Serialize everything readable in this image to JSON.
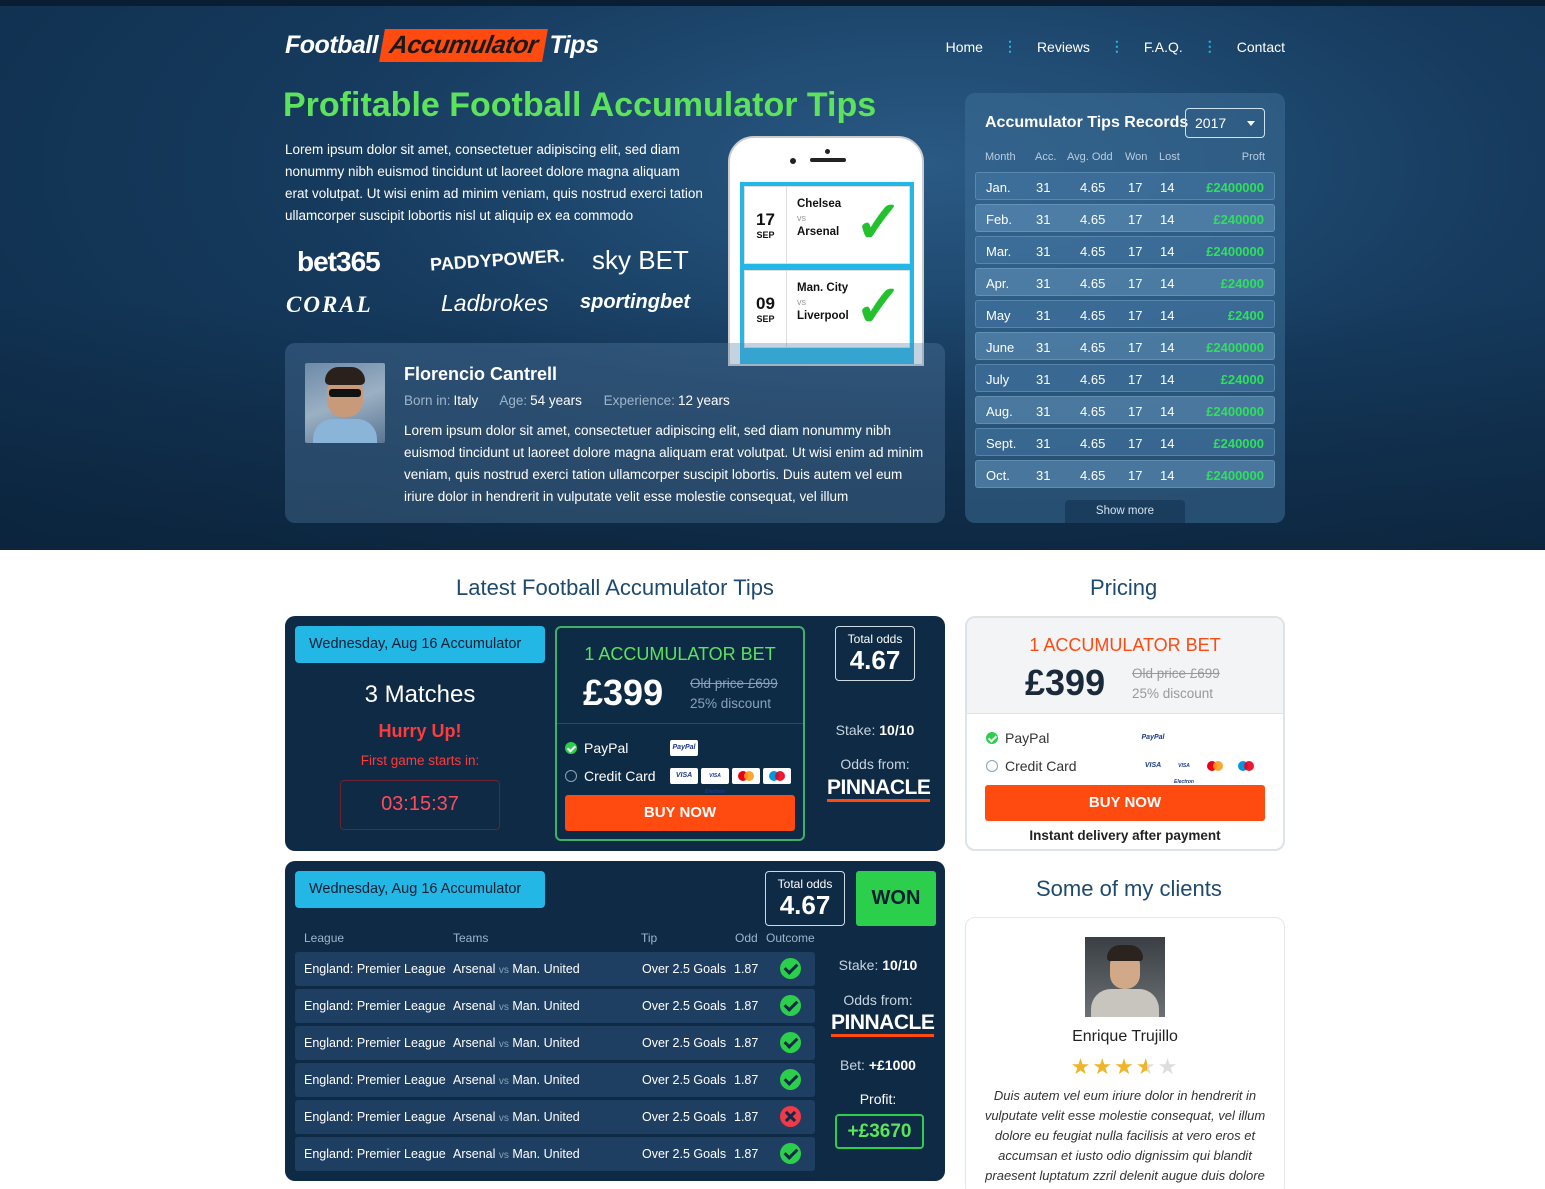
{
  "brand": {
    "part1": "Football",
    "part2": "Accumulator",
    "part3": "Tips"
  },
  "nav": [
    "Home",
    "Reviews",
    "F.A.Q.",
    "Contact"
  ],
  "hero": {
    "title": "Profitable Football Accumulator Tips",
    "intro": "Lorem ipsum dolor sit amet, consectetuer adipiscing elit, sed diam nonummy nibh euismod tincidunt ut laoreet dolore magna aliquam erat volutpat. Ut wisi enim ad minim veniam, quis nostrud exerci tation ullamcorper suscipit lobortis nisl ut aliquip ex ea commodo",
    "bookmakers": [
      "bet365",
      "PADDYPOWER.",
      "sky BET",
      "CORAL",
      "Ladbrokes",
      "sportingbet"
    ]
  },
  "phone": {
    "matches": [
      {
        "day": "17",
        "month": "SEP",
        "home": "Chelsea",
        "vs": "vs",
        "away": "Arsenal"
      },
      {
        "day": "09",
        "month": "SEP",
        "home": "Man. City",
        "vs": "vs",
        "away": "Liverpool"
      }
    ]
  },
  "tipster": {
    "name": "Florencio Cantrell",
    "born_label": "Born in:",
    "born": "Italy",
    "age_label": "Age:",
    "age": "54 years",
    "exp_label": "Experience:",
    "exp": "12 years",
    "bio": "Lorem ipsum dolor sit amet, consectetuer adipiscing elit, sed diam nonummy nibh euismod tincidunt ut laoreet dolore magna aliquam erat volutpat. Ut wisi enim ad minim veniam, quis nostrud exerci tation ullamcorper suscipit lobortis. Duis autem vel eum iriure dolor in hendrerit in vulputate velit esse molestie consequat, vel illum"
  },
  "records": {
    "title": "Accumulator Tips Records",
    "year": "2017",
    "headers": [
      "Month",
      "Acc.",
      "Avg. Odd",
      "Won",
      "Lost",
      "Proft"
    ],
    "rows": [
      [
        "Jan.",
        "31",
        "4.65",
        "17",
        "14",
        "£2400000"
      ],
      [
        "Feb.",
        "31",
        "4.65",
        "17",
        "14",
        "£240000"
      ],
      [
        "Mar.",
        "31",
        "4.65",
        "17",
        "14",
        "£2400000"
      ],
      [
        "Apr.",
        "31",
        "4.65",
        "17",
        "14",
        "£24000"
      ],
      [
        "May",
        "31",
        "4.65",
        "17",
        "14",
        "£2400"
      ],
      [
        "June",
        "31",
        "4.65",
        "17",
        "14",
        "£2400000"
      ],
      [
        "July",
        "31",
        "4.65",
        "17",
        "14",
        "£24000"
      ],
      [
        "Aug.",
        "31",
        "4.65",
        "17",
        "14",
        "£2400000"
      ],
      [
        "Sept.",
        "31",
        "4.65",
        "17",
        "14",
        "£240000"
      ],
      [
        "Oct.",
        "31",
        "4.65",
        "17",
        "14",
        "£2400000"
      ]
    ],
    "show_more": "Show more"
  },
  "latest": {
    "heading": "Latest Football Accumulator Tips",
    "card1": {
      "date": "Wednesday, Aug 16 Accumulator",
      "matches": "3 Matches",
      "hurry": "Hurry Up!",
      "starts": "First game starts in:",
      "countdown": "03:15:37",
      "offer_title": "1 ACCUMULATOR BET",
      "price": "£399",
      "old_price": "Old price £699",
      "discount": "25% discount",
      "paypal": "PayPal",
      "credit": "Credit Card",
      "buy": "BUY NOW",
      "total_label": "Total odds",
      "total": "4.67",
      "stake_label": "Stake:",
      "stake": "10/10",
      "odds_from": "Odds from:",
      "bookie": "PINNACLE"
    },
    "card2": {
      "date": "Wednesday, Aug 16 Accumulator",
      "total_label": "Total odds",
      "total": "4.67",
      "status": "WON",
      "headers": [
        "League",
        "Teams",
        "Tip",
        "Odd",
        "Outcome"
      ],
      "rows": [
        {
          "league": "England: Premier League",
          "home": "Arsenal",
          "vs": "vs",
          "away": "Man. United",
          "tip": "Over 2.5 Goals",
          "odd": "1.87",
          "outcome": "win"
        },
        {
          "league": "England: Premier League",
          "home": "Arsenal",
          "vs": "vs",
          "away": "Man. United",
          "tip": "Over 2.5 Goals",
          "odd": "1.87",
          "outcome": "win"
        },
        {
          "league": "England: Premier League",
          "home": "Arsenal",
          "vs": "vs",
          "away": "Man. United",
          "tip": "Over 2.5 Goals",
          "odd": "1.87",
          "outcome": "win"
        },
        {
          "league": "England: Premier League",
          "home": "Arsenal",
          "vs": "vs",
          "away": "Man. United",
          "tip": "Over 2.5 Goals",
          "odd": "1.87",
          "outcome": "win"
        },
        {
          "league": "England: Premier League",
          "home": "Arsenal",
          "vs": "vs",
          "away": "Man. United",
          "tip": "Over 2.5 Goals",
          "odd": "1.87",
          "outcome": "lose"
        },
        {
          "league": "England: Premier League",
          "home": "Arsenal",
          "vs": "vs",
          "away": "Man. United",
          "tip": "Over 2.5 Goals",
          "odd": "1.87",
          "outcome": "win"
        }
      ],
      "stake_label": "Stake:",
      "stake": "10/10",
      "odds_from": "Odds from:",
      "bookie": "PINNACLE",
      "bet_label": "Bet:",
      "bet": "+£1000",
      "profit_label": "Profit:",
      "profit": "+£3670"
    }
  },
  "pricing": {
    "heading": "Pricing",
    "title": "1 ACCUMULATOR BET",
    "price": "£399",
    "old_price": "Old price £699",
    "discount": "25% discount",
    "paypal": "PayPal",
    "credit": "Credit Card",
    "buy": "BUY NOW",
    "delivery": "Instant delivery after payment"
  },
  "clients": {
    "heading": "Some of my clients",
    "name": "Enrique Trujillo",
    "rating": 3.5,
    "quote": "Duis autem vel eum iriure dolor in hendrerit in vulputate velit esse molestie consequat, vel illum dolore eu feugiat nulla facilisis at vero eros et accumsan et iusto odio dignissim qui blandit praesent luptatum zzril delenit augue duis dolore"
  },
  "payment_badges": [
    "PayPal",
    "VISA",
    "VISA Electron",
    "MasterCard",
    "Maestro"
  ],
  "colors": {
    "accent_green": "#5de25b",
    "accent_orange": "#ff4a10",
    "accent_blue": "#23b7e5",
    "navy": "#0f2a45"
  }
}
